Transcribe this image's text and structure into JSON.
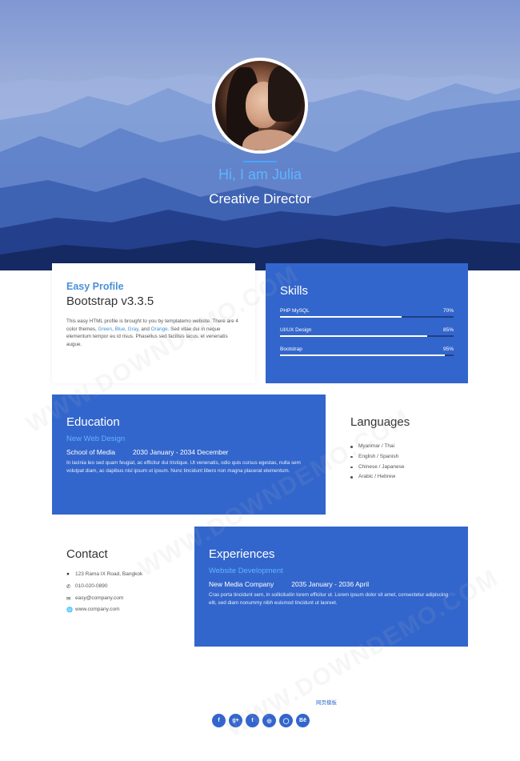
{
  "hero": {
    "name": "Hi, I am Julia",
    "role": "Creative Director"
  },
  "profile": {
    "subtitle": "Easy Profile",
    "title": "Bootstrap v3.3.5",
    "text_1": "This easy HTML profile is brought to you by templatemo website. There are 4 color themes, ",
    "green": "Green",
    "sep1": ", ",
    "blue": "Blue",
    "sep2": ", ",
    "gray": "Gray",
    "sep3": ", and ",
    "orange": "Orange",
    "text_2": ". Sed vitae dui in neque elementum tempor eu id risus. Phasellus sed facilisis lacus, et venenatis augue."
  },
  "skills": {
    "title": "Skills",
    "items": [
      {
        "label": "PHP MySQL",
        "percent_label": "70%",
        "percent": 70
      },
      {
        "label": "UI/UX Design",
        "percent_label": "85%",
        "percent": 85
      },
      {
        "label": "Bootstrap",
        "percent_label": "95%",
        "percent": 95
      }
    ]
  },
  "education": {
    "title": "Education",
    "subtitle": "New Web Design",
    "school": "School of Media",
    "dates": "2030 January - 2034 December",
    "text": "In lacinia leo sed quam feugiat, ac efficitur dui tristique. Ut venenatis, odio quis cursus egestas, nulla sem volutpat diam, ac dapibus nisl ipsum ut ipsum. Nunc tincidunt libero non magna placerat elementum."
  },
  "languages": {
    "title": "Languages",
    "items": [
      "Myanmar / Thai",
      "English / Spanish",
      "Chinese / Japanese",
      "Arabic / Hebrew"
    ]
  },
  "contact": {
    "title": "Contact",
    "address": "123 Rama IX Road, Bangkok",
    "phone": "010-020-0890",
    "email": "easy@company.com",
    "website": "www.company.com"
  },
  "experiences": {
    "title": "Experiences",
    "subtitle": "Website Development",
    "company": "New Media Company",
    "dates": "2035 January - 2036 April",
    "text": "Cras porta tincidunt sem, in sollicitudin lorem efficitur ut. Lorem ipsum dolor sit amet, consectetur adipiscing elit, sed diam nonummy nibh euismod tincidunt ut laoreet."
  },
  "footer": {
    "link": "网页模板",
    "social": [
      "f",
      "g+",
      "t",
      "◎",
      "◯",
      "Bē"
    ]
  },
  "watermark": "WWW.DOWNDEMO.COM",
  "colors": {
    "accent": "#3366cc",
    "highlight": "#5fb4ff"
  }
}
